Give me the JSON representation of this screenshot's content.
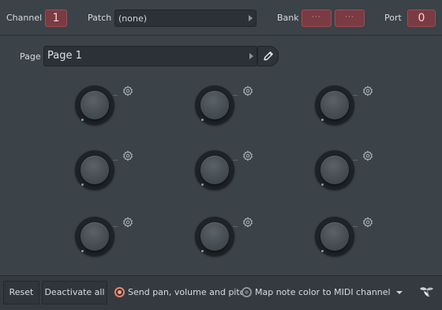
{
  "header": {
    "channel_label": "Channel",
    "channel_value": "1",
    "patch_label": "Patch",
    "patch_value": "(none)",
    "bank_label": "Bank",
    "bank_value1": "···",
    "bank_value2": "···",
    "port_label": "Port",
    "port_value": "0"
  },
  "page": {
    "label": "Page",
    "value": "Page 1"
  },
  "knobs": [
    {
      "row": 1,
      "col": 1
    },
    {
      "row": 1,
      "col": 2
    },
    {
      "row": 1,
      "col": 3
    },
    {
      "row": 2,
      "col": 1
    },
    {
      "row": 2,
      "col": 2
    },
    {
      "row": 2,
      "col": 3
    },
    {
      "row": 3,
      "col": 1
    },
    {
      "row": 3,
      "col": 2
    },
    {
      "row": 3,
      "col": 3
    }
  ],
  "footer": {
    "reset_label": "Reset",
    "deactivate_label": "Deactivate all",
    "option1_label": "Send pan, volume and pitch",
    "option1_selected": true,
    "option2_label": "Map note color to MIDI channel",
    "option2_selected": false
  },
  "colors": {
    "background": "#3b4248",
    "accent_red": "#7a3b42",
    "radio_active": "#e8846a"
  },
  "icons": {
    "edit": "pencil-icon",
    "knob_settings": "gear-icon",
    "menu": "chevron-down-icon",
    "fruit": "fruit-icon"
  }
}
